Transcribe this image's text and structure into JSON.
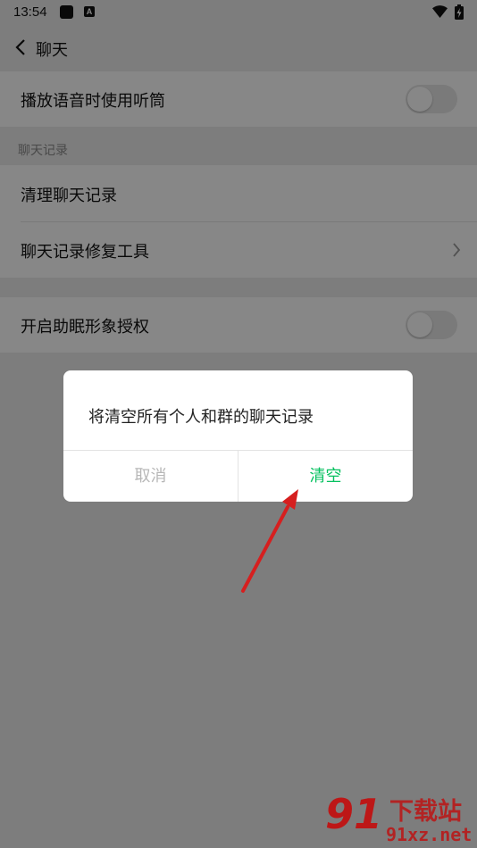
{
  "status_bar": {
    "time": "13:54",
    "app_badge": "A"
  },
  "header": {
    "title": "聊天"
  },
  "settings": {
    "earpiece_voice": {
      "label": "播放语音时使用听筒",
      "enabled": false
    },
    "section_chat_history": "聊天记录",
    "clear_history": {
      "label": "清理聊天记录"
    },
    "repair_tool": {
      "label": "聊天记录修复工具"
    },
    "sleep_avatar_auth": {
      "label": "开启助眠形象授权",
      "enabled": false
    }
  },
  "dialog": {
    "message": "将清空所有个人和群的聊天记录",
    "cancel_label": "取消",
    "confirm_label": "清空"
  },
  "watermark": {
    "logo_text": "91",
    "site_name": "下载站",
    "url": "91xz.net"
  },
  "colors": {
    "accent": "#07c160",
    "annotation_arrow": "#d61f1f",
    "watermark": "#c40d0d"
  }
}
